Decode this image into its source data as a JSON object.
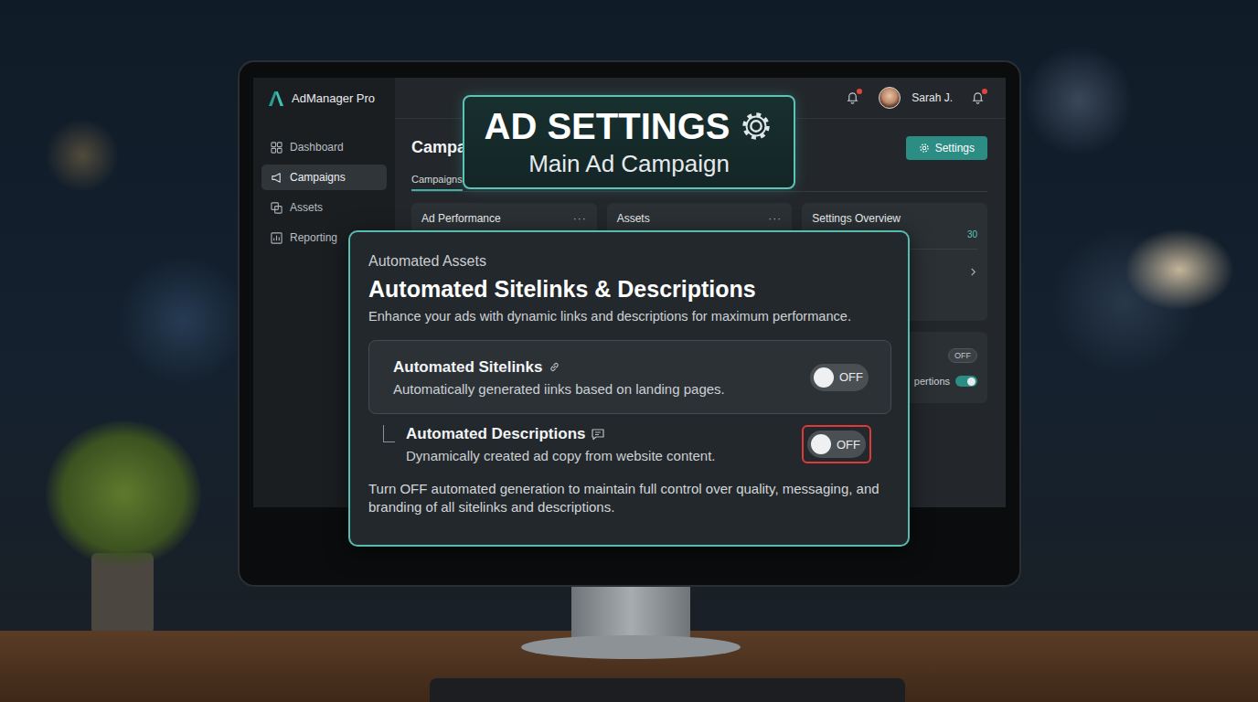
{
  "app": {
    "name": "AdManager Pro"
  },
  "sidebar": {
    "items": [
      {
        "label": "Dashboard",
        "selected": false
      },
      {
        "label": "Campaigns",
        "selected": true
      },
      {
        "label": "Assets",
        "selected": false
      },
      {
        "label": "Reporting",
        "selected": false
      }
    ]
  },
  "header": {
    "user": "Sarah J.",
    "bells": [
      {
        "unread": true
      },
      {
        "unread": true
      }
    ],
    "settings_button": "Settings"
  },
  "page": {
    "title": "Campa",
    "tabs": [
      {
        "label": "Campaigns",
        "selected": true
      }
    ]
  },
  "cards": [
    {
      "title": "Ad Performance",
      "menu": "···"
    },
    {
      "title": "Assets",
      "menu": "···"
    }
  ],
  "settings_overview": {
    "title": "Settings Overview",
    "value": "30"
  },
  "settings_rows": [
    {
      "kind": "pill",
      "label": "",
      "badge": "OFF",
      "on": false
    },
    {
      "kind": "toggle",
      "label": "pertions",
      "badge": "",
      "on": true
    }
  ],
  "banner": {
    "title": "AD SETTINGS",
    "subtitle": "Main Ad Campaign"
  },
  "modal": {
    "eyebrow": "Automated Assets",
    "title": "Automated Sitelinks & Descriptions",
    "subtitle": "Enhance your ads with dynamic links and descriptions for maximum performance.",
    "options": [
      {
        "label": "Automated Sitelinks",
        "description": "Automatically generated iinks based on landing pages.",
        "on": false,
        "toggle_text": "OFF",
        "highlighted": false,
        "nested": false
      },
      {
        "label": "Automated Descriptions",
        "description": "Dynamically created ad copy from website content.",
        "on": false,
        "toggle_text": "OFF",
        "highlighted": true,
        "nested": true
      }
    ],
    "note": "Turn OFF automated generation to maintain full control over quality, messaging, and branding of all sitelinks and descriptions."
  }
}
